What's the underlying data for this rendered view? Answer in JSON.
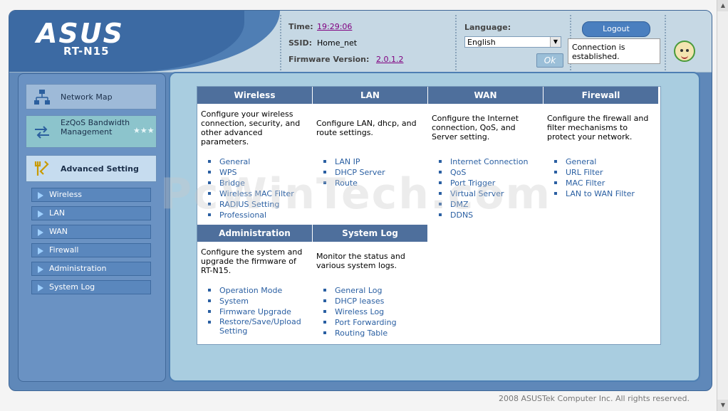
{
  "brand": {
    "logo": "ASUS",
    "model": "RT-N15"
  },
  "status": {
    "time_label": "Time:",
    "time_value": "19:29:06",
    "ssid_label": "SSID:",
    "ssid_value": "Home_net",
    "firmware_label": "Firmware Version:",
    "firmware_value": "2.0.1.2"
  },
  "language": {
    "label": "Language:",
    "selected": "English",
    "ok_label": "Ok"
  },
  "logout_label": "Logout",
  "connection_text": "Connection is established.",
  "sidebar": {
    "main": [
      {
        "label": "Network Map",
        "icon": "network-map-icon"
      },
      {
        "label": "EzQoS Bandwidth Management",
        "icon": "ezqos-icon"
      },
      {
        "label": "Advanced Setting",
        "icon": "tools-icon"
      }
    ],
    "sub": [
      {
        "label": "Wireless"
      },
      {
        "label": "LAN"
      },
      {
        "label": "WAN"
      },
      {
        "label": "Firewall"
      },
      {
        "label": "Administration"
      },
      {
        "label": "System Log"
      }
    ]
  },
  "sections": [
    {
      "title": "Wireless",
      "desc": "Configure your wireless connection, security, and other advanced parameters.",
      "links": [
        "General",
        "WPS",
        "Bridge",
        "Wireless MAC Filter",
        "RADIUS Setting",
        "Professional"
      ]
    },
    {
      "title": "LAN",
      "desc": "Configure LAN, dhcp, and route settings.",
      "links": [
        "LAN IP",
        "DHCP Server",
        "Route"
      ]
    },
    {
      "title": "WAN",
      "desc": "Configure the Internet connection, QoS, and Server setting.",
      "links": [
        "Internet Connection",
        "QoS",
        "Port Trigger",
        "Virtual Server",
        "DMZ",
        "DDNS"
      ]
    },
    {
      "title": "Firewall",
      "desc": "Configure the firewall and filter mechanisms to protect your network.",
      "links": [
        "General",
        "URL Filter",
        "MAC Filter",
        "LAN to WAN Filter"
      ]
    },
    {
      "title": "Administration",
      "desc": "Configure the system and upgrade the firmware of RT-N15.",
      "links": [
        "Operation Mode",
        "System",
        "Firmware Upgrade",
        "Restore/Save/Upload Setting"
      ]
    },
    {
      "title": "System Log",
      "desc": "Monitor the status and various system logs.",
      "links": [
        "General Log",
        "DHCP leases",
        "Wireless Log",
        "Port Forwarding",
        "Routing Table"
      ]
    }
  ],
  "watermark": "PcWinTech.com",
  "footer": "2008 ASUSTek Computer Inc. All rights reserved.",
  "colors": {
    "accent": "#4e6f9c",
    "link": "#2a5fa2",
    "sidebar": "#6a92c3",
    "content_bg": "#a9cde0"
  }
}
